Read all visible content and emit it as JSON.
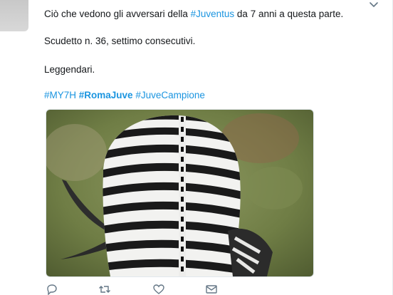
{
  "tweet": {
    "text_before_tag": "Ciò che vedono gli avversari della ",
    "tag_juventus": "#Juventus",
    "text_after_tag": " da 7 anni a questa parte.",
    "line2": "Scudetto n. 36, settimo consecutivi.",
    "line3": "Leggendari.",
    "hashtags": {
      "h1": "#MY7H",
      "h2": "#RomaJuve",
      "h3": "#JuveCampione"
    }
  },
  "colors": {
    "link": "#1b95e0",
    "text": "#14171a",
    "icon": "#657786"
  },
  "icons": {
    "reply": "reply-icon",
    "retweet": "retweet-icon",
    "like": "heart-icon",
    "message": "envelope-icon",
    "more": "chevron-down-icon"
  }
}
